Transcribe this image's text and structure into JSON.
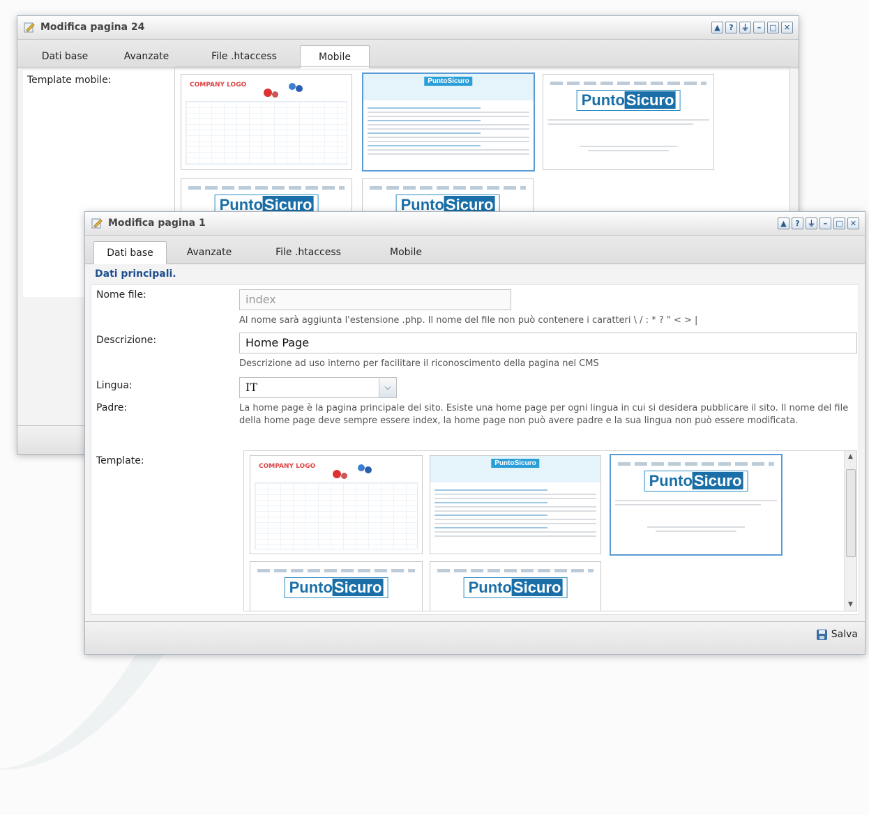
{
  "back_window": {
    "title": "Modifica pagina 24",
    "tabs": [
      {
        "label": "Dati base"
      },
      {
        "label": "Avanzate"
      },
      {
        "label": "File .htaccess"
      },
      {
        "label": "Mobile",
        "active": true
      }
    ],
    "field_label": "Template mobile:",
    "window_buttons": [
      "▲",
      "?",
      "⏚",
      "–",
      "□",
      "✕"
    ]
  },
  "front_window": {
    "title": "Modifica pagina 1",
    "tabs": [
      {
        "label": "Dati base",
        "active": true
      },
      {
        "label": "Avanzate"
      },
      {
        "label": "File .htaccess"
      },
      {
        "label": "Mobile"
      }
    ],
    "section_title": "Dati principali.",
    "nome_file": {
      "label": "Nome file:",
      "value": "index",
      "hint": "Al nome sarà aggiunta l'estensione .php. Il nome del file non può contenere i caratteri \\ / : * ? \" < > |"
    },
    "descrizione": {
      "label": "Descrizione:",
      "value": "Home Page",
      "hint": "Descrizione ad uso interno per facilitare il riconoscimento della pagina nel CMS"
    },
    "lingua": {
      "label": "Lingua:",
      "value": "IT"
    },
    "padre": {
      "label": "Padre:",
      "text": "La home page è la pagina principale del sito. Esiste una home page per ogni lingua in cui si desidera pubblicare il sito. Il nome del file della home page deve sempre essere index, la home page non può avere padre e la sua lingua non può essere modificata."
    },
    "template": {
      "label": "Template:"
    },
    "save_label": "Salva"
  },
  "thumbnail_texts": {
    "company_logo": "COMPANY LOGO",
    "brand_part1": "Punto",
    "brand_part2": "Sicuro"
  }
}
